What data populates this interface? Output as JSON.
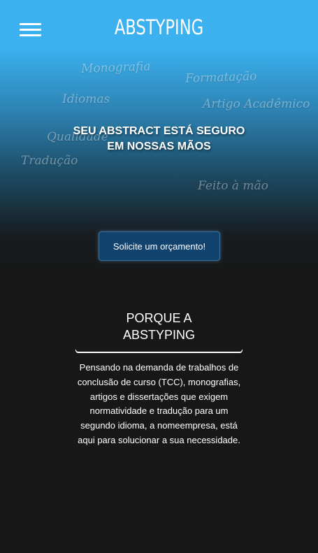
{
  "header": {
    "brand": "ABSTYPING",
    "menu_icon": "hamburger-menu-icon"
  },
  "hero": {
    "floating_words": [
      "Monografia",
      "Formatação",
      "Idiomas",
      "Artigo Acadêmico",
      "Qualidade",
      "Tradução",
      "Feito à mão"
    ],
    "tagline_lines": [
      "SEU ABSTRACT ESTÁ SEGURO",
      "EM NOSSAS MÃOS"
    ],
    "cta_label": "Solicite um orçamento!"
  },
  "why": {
    "title_lines": [
      "PORQUE A",
      "ABSTYPING"
    ],
    "description_lines": [
      "Pensando na demanda de trabalhos de",
      "conclusão de curso (TCC), monografias,",
      "artigos e dissertações que exigem",
      "normatividade e tradução para um",
      "segundo idioma, a nomeempresa, está",
      "aqui para solucionar a sua necessidade."
    ]
  },
  "colors": {
    "header_blue": "#3bb1ef",
    "background_dark": "#171717",
    "button_blue": "#12436e"
  }
}
